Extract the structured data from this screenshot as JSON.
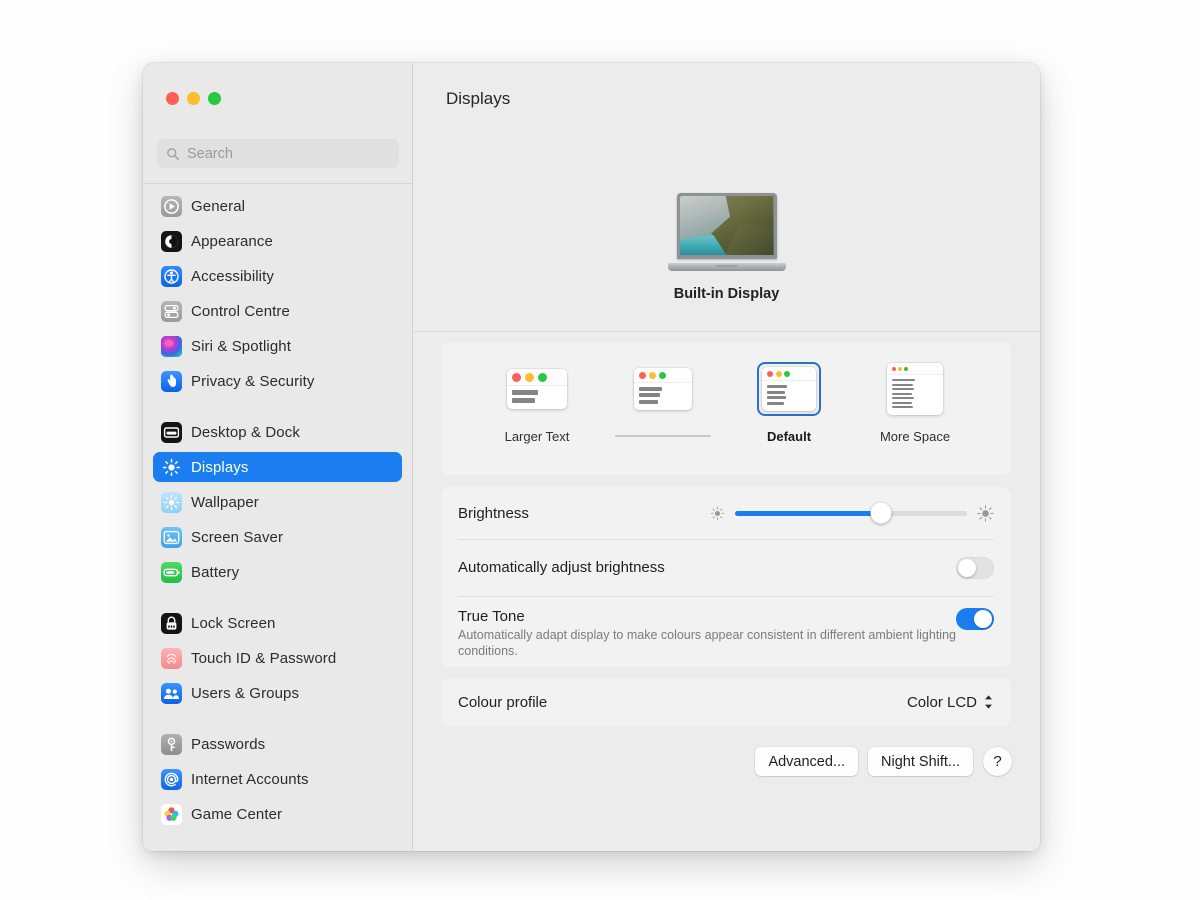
{
  "window": {
    "traffic_lights": [
      {
        "name": "close-button",
        "color": "#ff5f57"
      },
      {
        "name": "minimize-button",
        "color": "#febc2e"
      },
      {
        "name": "maximize-button",
        "color": "#28c840"
      }
    ]
  },
  "sidebar": {
    "search": {
      "placeholder": "Search",
      "value": "",
      "icon": "search-icon"
    },
    "groups": [
      {
        "items": [
          {
            "label": "General",
            "icon": "general-icon",
            "selected": false
          },
          {
            "label": "Appearance",
            "icon": "appearance-icon",
            "selected": false
          },
          {
            "label": "Accessibility",
            "icon": "accessibility-icon",
            "selected": false
          },
          {
            "label": "Control Centre",
            "icon": "control-centre-icon",
            "selected": false
          },
          {
            "label": "Siri & Spotlight",
            "icon": "siri-icon",
            "selected": false
          },
          {
            "label": "Privacy & Security",
            "icon": "privacy-icon",
            "selected": false
          }
        ]
      },
      {
        "items": [
          {
            "label": "Desktop & Dock",
            "icon": "desktop-dock-icon",
            "selected": false
          },
          {
            "label": "Displays",
            "icon": "displays-icon",
            "selected": true
          },
          {
            "label": "Wallpaper",
            "icon": "wallpaper-icon",
            "selected": false
          },
          {
            "label": "Screen Saver",
            "icon": "screen-saver-icon",
            "selected": false
          },
          {
            "label": "Battery",
            "icon": "battery-icon",
            "selected": false
          }
        ]
      },
      {
        "items": [
          {
            "label": "Lock Screen",
            "icon": "lock-screen-icon",
            "selected": false
          },
          {
            "label": "Touch ID & Password",
            "icon": "touch-id-icon",
            "selected": false
          },
          {
            "label": "Users & Groups",
            "icon": "users-groups-icon",
            "selected": false
          }
        ]
      },
      {
        "items": [
          {
            "label": "Passwords",
            "icon": "passwords-icon",
            "selected": false
          },
          {
            "label": "Internet Accounts",
            "icon": "internet-accounts-icon",
            "selected": false
          },
          {
            "label": "Game Center",
            "icon": "game-center-icon",
            "selected": false
          }
        ]
      }
    ],
    "selected_accent": "#1a7ef0"
  },
  "main": {
    "title": "Displays",
    "display": {
      "name": "Built-in Display",
      "icon": "macbook-icon"
    },
    "scaling": {
      "options": [
        {
          "label": "Larger Text",
          "selected": false,
          "connector": false,
          "thumb_width": 60,
          "thumb_dot": 9,
          "line_height": 5,
          "lines": [
            52,
            46
          ]
        },
        {
          "label": "",
          "selected": false,
          "connector": true,
          "thumb_width": 58,
          "thumb_dot": 7,
          "line_height": 4,
          "lines": [
            48,
            44,
            40
          ]
        },
        {
          "label": "Default",
          "selected": true,
          "connector": false,
          "thumb_width": 54,
          "thumb_dot": 6,
          "line_height": 3,
          "lines": [
            46,
            42,
            44,
            38
          ]
        },
        {
          "label": "More Space",
          "selected": false,
          "connector": false,
          "thumb_width": 56,
          "thumb_dot": 4,
          "line_height": 2,
          "lines": [
            50,
            46,
            48,
            44,
            47,
            43,
            45
          ]
        }
      ]
    },
    "brightness": {
      "label": "Brightness",
      "value_percent": 63,
      "low_icon": "brightness-low-icon",
      "high_icon": "brightness-high-icon",
      "accent": "#1a7ef0"
    },
    "auto_brightness": {
      "label": "Automatically adjust brightness",
      "enabled": false
    },
    "true_tone": {
      "label": "True Tone",
      "description": "Automatically adapt display to make colours appear consistent in different ambient lighting conditions.",
      "enabled": true
    },
    "colour_profile": {
      "label": "Colour profile",
      "value": "Color LCD",
      "stepper_icon": "chevron-updown-icon"
    },
    "buttons": {
      "advanced": "Advanced...",
      "night_shift": "Night Shift...",
      "help": "?"
    }
  }
}
